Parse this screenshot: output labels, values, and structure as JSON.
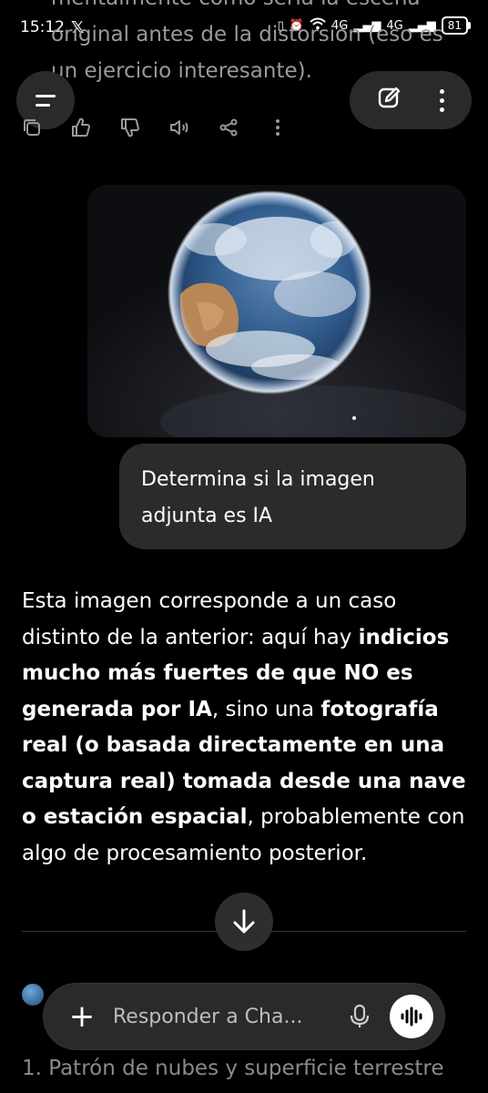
{
  "status_bar": {
    "time": "15:12",
    "app_logo": "𝕏",
    "net1": "4G",
    "net2": "4G",
    "battery": "81"
  },
  "previous_message_fragment": "mentalmente cómo sería la escena original antes de la distorsión (eso es un ejercicio interesante).",
  "user_message": {
    "text": "Determina si la imagen adjunta es IA",
    "image_desc_icon": "earth-photo"
  },
  "answer": {
    "p1": "Esta imagen corresponde a un caso distinto de la anterior: aquí hay ",
    "b1": "indicios mucho más fuertes de que NO es generada por IA",
    "p2": ", sino una ",
    "b2": "fotografía real (o basada directamente en una captura real) tomada desde una nave o estación espacial",
    "p3": ", probablemente con algo de procesamiento posterior."
  },
  "bottom_fragment": "1. Patrón de nubes y superficie terrestre",
  "composer": {
    "placeholder": "Responder a Cha..."
  },
  "icons": [
    "menu-icon",
    "edit-icon",
    "more-icon",
    "copy-icon",
    "thumbs-up-icon",
    "thumbs-down-icon",
    "read-aloud-icon",
    "share-icon",
    "more-vertical-icon",
    "arrow-down-icon",
    "plus-icon",
    "mic-icon",
    "voice-mode-icon"
  ]
}
